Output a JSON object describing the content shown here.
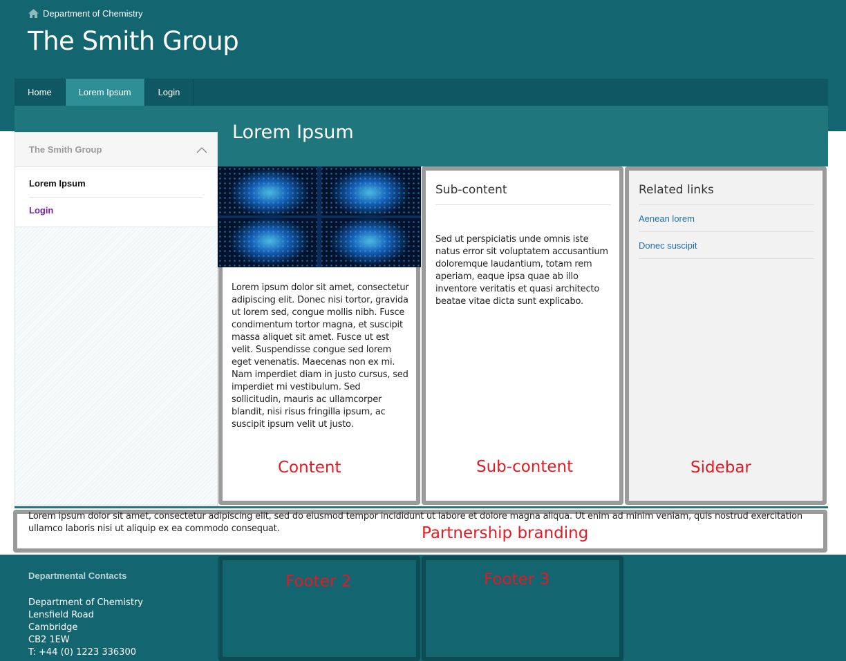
{
  "header": {
    "breadcrumb_label": "Department of Chemistry",
    "breadcrumb_icon": "home-icon",
    "site_title": "The Smith Group"
  },
  "nav": {
    "items": [
      {
        "label": "Home",
        "active": false
      },
      {
        "label": "Lorem Ipsum",
        "active": true
      },
      {
        "label": "Login",
        "active": false
      }
    ]
  },
  "page": {
    "title": "Lorem Ipsum"
  },
  "leftnav": {
    "heading": "The Smith Group",
    "items": [
      {
        "label": "Lorem Ipsum",
        "current": true
      },
      {
        "label": "Login",
        "current": false
      }
    ]
  },
  "content": {
    "body": "Lorem ipsum dolor sit amet, consectetur adipiscing elit. Donec nisi tortor, gravida ut lorem sed, congue mollis nibh. Fusce condimentum tortor magna, et suscipit massa aliquet sit amet. Fusce ut est velit. Suspendisse congue sed lorem eget venenatis. Maecenas non ex mi. Nam imperdiet diam in justo cursus, sed imperdiet mi vestibulum. Sed sollicitudin, mauris ac ullamcorper blandit, nisi risus fringilla ipsum, ac suscipit ipsum velit ut justo."
  },
  "subcontent": {
    "heading": "Sub-content",
    "body": "Sed ut perspiciatis unde omnis iste natus error sit voluptatem accusantium doloremque laudantium, totam rem aperiam, eaque ipsa quae ab illo inventore veritatis et quasi architecto beatae vitae dicta sunt explicabo."
  },
  "sidebar": {
    "heading": "Related links",
    "links": [
      "Aenean lorem",
      "Donec suscipit"
    ]
  },
  "partnership": {
    "body": "Lorem ipsum dolor sit amet, consectetur adipiscing elit, sed do eiusmod tempor incididunt ut labore et dolore magna aliqua. Ut enim ad minim veniam, quis nostrud exercitation ullamco laboris nisi ut aliquip ex ea commodo consequat."
  },
  "region_labels": {
    "content": "Content",
    "subcontent": "Sub-content",
    "sidebar": "Sidebar",
    "partnership": "Partnership branding",
    "footer2": "Footer 2",
    "footer3": "Footer 3"
  },
  "footer": {
    "heading": "Departmental Contacts",
    "lines": [
      "Department of Chemistry",
      "Lensfield Road",
      "Cambridge",
      "CB2 1EW",
      "T: +44 (0) 1223 336300"
    ]
  },
  "colors": {
    "brand_teal": "#136570",
    "nav_dark": "#0f5863",
    "nav_active": "#2f8f96",
    "title_band": "#1f767d",
    "annotation_red": "#e01b24",
    "link_blue": "#1e6fb0",
    "visited_purple": "#7a1fa2"
  }
}
